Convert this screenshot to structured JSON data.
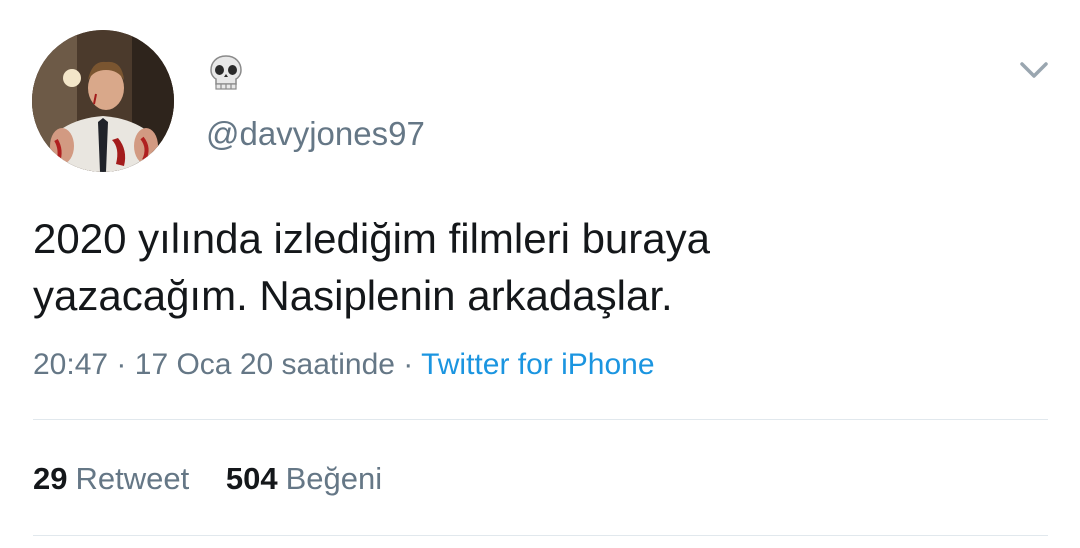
{
  "tweet": {
    "display_name_icon": "skull-emoji",
    "handle": "@davyjones97",
    "text_lines": [
      "2020 yılında izlediğim filmleri buraya",
      "yazacağım. Nasiplenin arkadaşlar."
    ],
    "time": "20:47",
    "date_text": "17 Oca 20 saatinde",
    "separator": "·",
    "source": "Twitter for iPhone"
  },
  "stats": {
    "retweet_count": "29",
    "retweet_label": "Retweet",
    "like_count": "504",
    "like_label": "Beğeni"
  },
  "icons": {
    "menu": "chevron-down-icon"
  },
  "colors": {
    "text": "#14171a",
    "secondary": "#657786",
    "link": "#1b95e0",
    "divider": "#e1e8ed"
  }
}
